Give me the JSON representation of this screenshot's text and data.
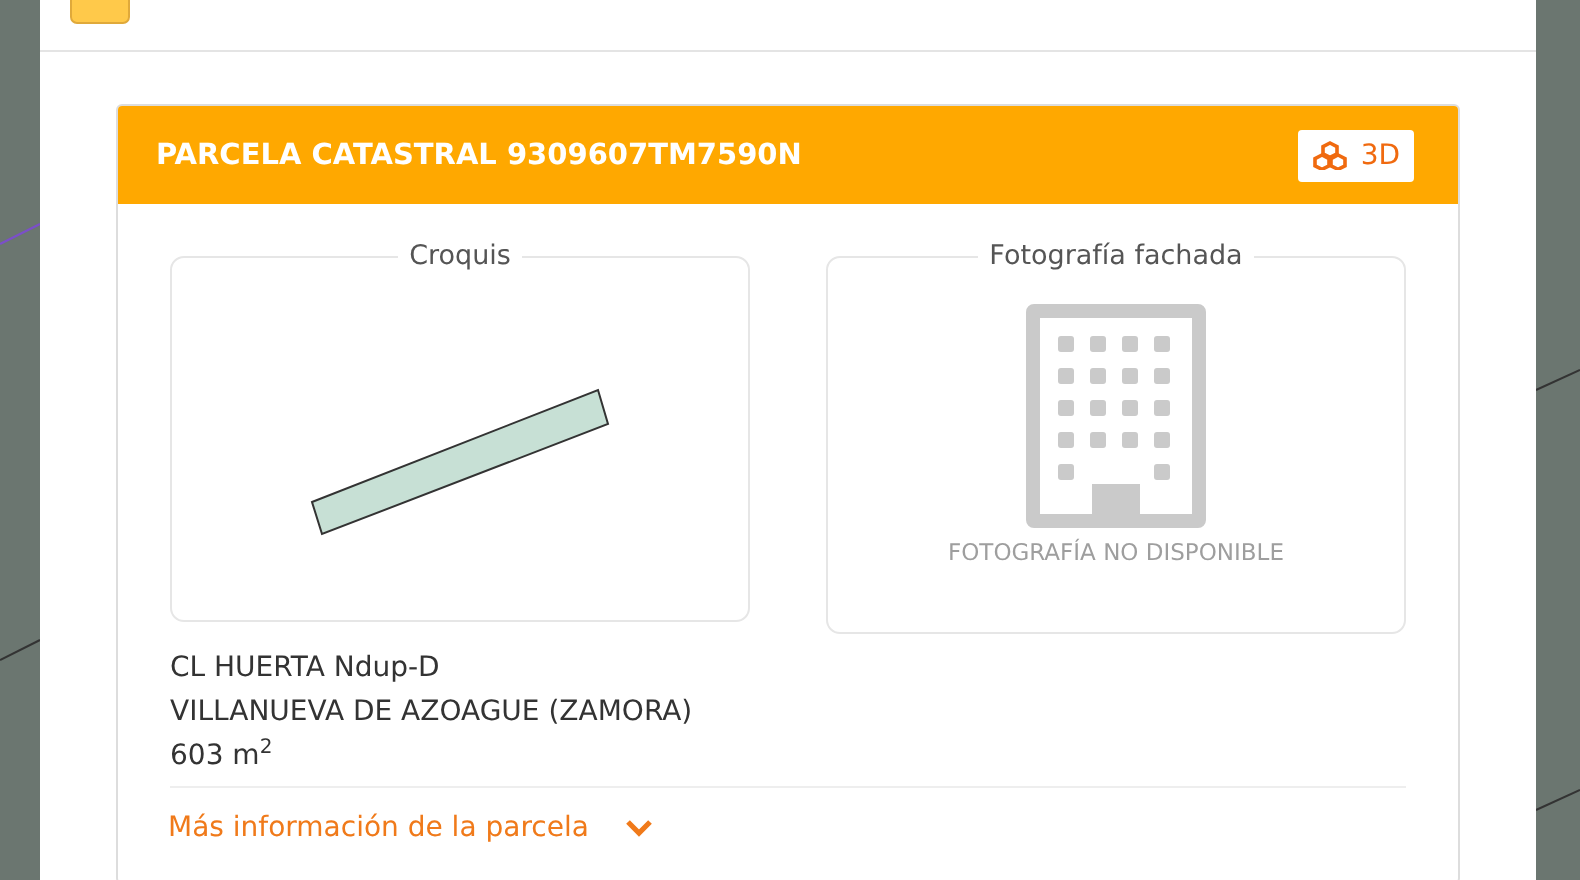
{
  "card": {
    "title": "PARCELA CATASTRAL 9309607TM7590N",
    "button_3d": "3D",
    "sketch": {
      "legend": "Croquis"
    },
    "photo": {
      "legend": "Fotografía fachada",
      "notice": "FOTOGRAFÍA NO DISPONIBLE"
    },
    "address": [
      "CL HUERTA Ndup-D",
      "VILLANUEVA DE AZOAGUE (ZAMORA)"
    ],
    "area": "603 m$^{2}$",
    "more_link": "Más información de la parcela"
  }
}
